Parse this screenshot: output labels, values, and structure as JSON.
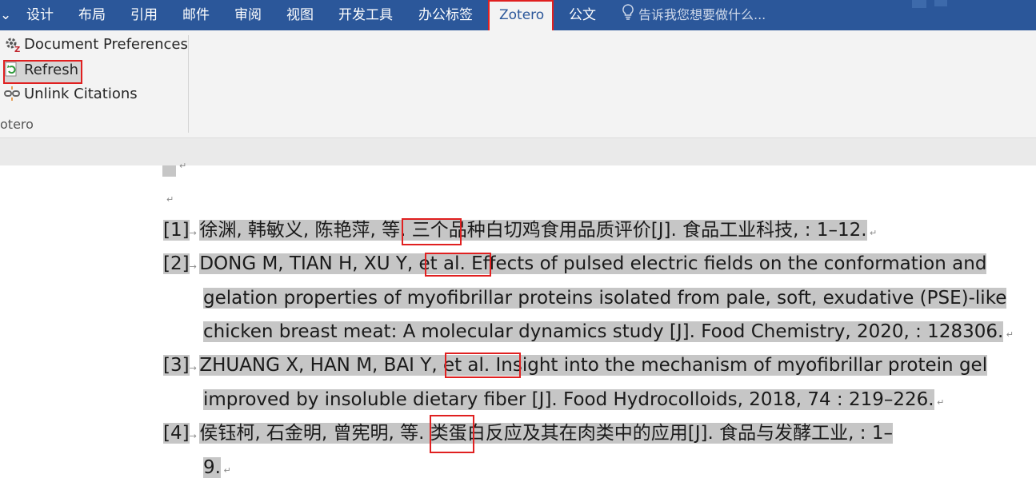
{
  "ribbon": {
    "tabs": [
      "设计",
      "布局",
      "引用",
      "邮件",
      "审阅",
      "视图",
      "开发工具",
      "办公标签",
      "Zotero",
      "公文"
    ],
    "active_tab": "Zotero",
    "tell_me": "告诉我您想要做什么...",
    "buttons": {
      "document_preferences": "Document Preferences",
      "refresh": "Refresh",
      "unlink_citations": "Unlink Citations"
    },
    "group_label": "otero"
  },
  "document": {
    "references": [
      {
        "num": "[1]",
        "lines": [
          "徐渊, 韩敏义, 陈艳萍, 等. 三个品种白切鸡食用品质评价[J]. 食品工业科技, : 1–12."
        ]
      },
      {
        "num": "[2]",
        "lines": [
          "DONG M, TIAN H, XU Y, et al. Effects of pulsed electric fields on the conformation and",
          "gelation properties of myofibrillar proteins isolated from pale, soft, exudative (PSE)-like",
          "chicken breast meat: A molecular dynamics study [J]. Food Chemistry, 2020, : 128306."
        ]
      },
      {
        "num": "[3]",
        "lines": [
          "ZHUANG X, HAN M, BAI Y, et al. Insight into the mechanism of myofibrillar protein gel",
          "improved by insoluble dietary fiber [J]. Food Hydrocolloids, 2018, 74 : 219–226."
        ]
      },
      {
        "num": "[4]",
        "lines": [
          "侯钰柯, 石金明, 曾宪明, 等. 类蛋白反应及其在肉类中的应用[J]. 食品与发酵工业, : 1–",
          "9."
        ]
      }
    ]
  },
  "colors": {
    "ribbon_blue": "#2b579a",
    "highlight_red": "#e02020",
    "selection_gray": "#c6c6c6"
  }
}
